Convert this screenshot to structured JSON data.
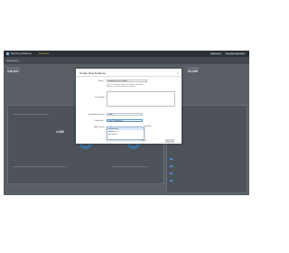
{
  "appbar": {
    "title": "Marketing Audience",
    "tab": "Audiences",
    "right_pills": [
      "Audiences",
      "Reusable Data Table"
    ]
  },
  "subbar": {
    "heading": "Overview",
    "chevron": "▾"
  },
  "dashboard": {
    "left_stat_label": "Total Contacts",
    "left_stat_value": "246,847",
    "right_stat_label": "Subscribers",
    "right_stat_value": "62,938",
    "mid_stat_1": "4,980",
    "mid_stat_2": "2,348"
  },
  "modal": {
    "title": "Create New Audience",
    "close": "✕",
    "name_label": "Name *",
    "name_value": "Audience for UI Delight",
    "name_help": "This is an audience that is about to be a Marketing Audience in our Marketplace & Vendors.",
    "description_label": "Description",
    "marketing_params_label": "Marketing Params",
    "marketing_params_value": "None",
    "audience_label": "Audience *",
    "audience_value": "Select a Audience",
    "add_interest_label": "Add Interest",
    "dropdown_items": [
      "Marketing",
      "Audience",
      "Contacts"
    ],
    "extra_label": "Interests",
    "cancel_label": "Cancel",
    "create_label": "Create"
  },
  "colors": {
    "accent": "#4f8fd1",
    "tab_accent": "#e9b24a",
    "appbar": "#2b2f36",
    "backdrop": "#5a5f66"
  },
  "icons": {
    "close": "close-icon",
    "dropdown_item": "circle-icon",
    "app_logo": "app-logo-icon"
  }
}
